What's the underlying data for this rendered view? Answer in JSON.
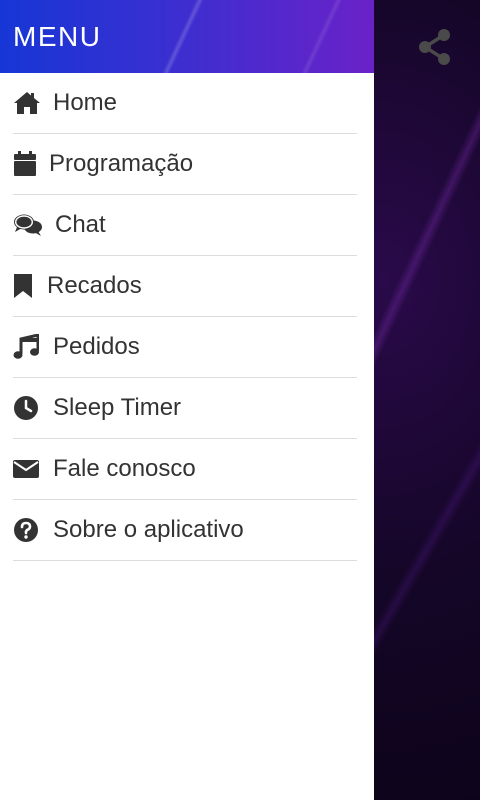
{
  "drawer": {
    "title": "MENU",
    "items": [
      {
        "label": "Home",
        "icon": "home-icon"
      },
      {
        "label": "Programação",
        "icon": "calendar-icon"
      },
      {
        "label": "Chat",
        "icon": "chat-icon"
      },
      {
        "label": "Recados",
        "icon": "bookmark-icon"
      },
      {
        "label": "Pedidos",
        "icon": "music-note-icon"
      },
      {
        "label": "Sleep Timer",
        "icon": "clock-icon"
      },
      {
        "label": "Fale conosco",
        "icon": "envelope-icon"
      },
      {
        "label": "Sobre o aplicativo",
        "icon": "question-circle-icon"
      }
    ]
  },
  "app": {
    "share_icon": "share-icon"
  },
  "colors": {
    "header_start": "#1736d6",
    "header_end": "#6a22c8",
    "text": "#333333",
    "divider": "#dcdcdc"
  }
}
